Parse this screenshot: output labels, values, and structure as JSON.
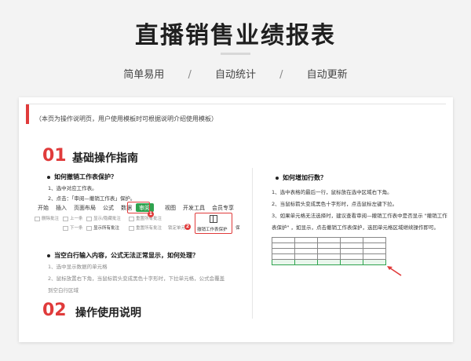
{
  "header": {
    "title": "直播销售业绩报表",
    "subtitles": [
      "简单易用",
      "自动统计",
      "自动更新"
    ],
    "separator": "/"
  },
  "card": {
    "note": "（本页为操作说明页，用户使用模板时可根据说明介绍使用模板）",
    "section1": {
      "num": "01",
      "title": "基础操作指南"
    },
    "section2": {
      "num": "02",
      "title": "操作使用说明"
    },
    "left": {
      "q1": "如何撤销工作表保护？",
      "q1_steps": [
        "1、选中对应工作表。",
        "2、点击：「审阅—撤销工作表」保护。"
      ],
      "ribbon_tabs": [
        "开始",
        "插入",
        "页面布局",
        "公式",
        "数据",
        "审阅",
        "视图",
        "开发工具",
        "会员专享"
      ],
      "ribbon_tools": [
        "删除批注",
        "上一条",
        "显示/隐藏批注",
        "重置所有批注",
        "锁定单元格",
        "撤销工作表保护",
        "保"
      ],
      "ribbon_tools_row2": [
        "下一条",
        "显示所有批注",
        "重置所有批注"
      ],
      "badges": [
        "1",
        "2"
      ],
      "q2": "当空白行输入内容，公式无法正常显示，如何处理？",
      "q2_steps": [
        "1、选中显示数据的单元格",
        "2、鼠标放置右下角，当鼠标箭头变成黑色十字形时，下拉单元格，公式会覆盖",
        "到空白行区域"
      ]
    },
    "right": {
      "q": "如何增加行数？",
      "steps": [
        "1、选中表格的最后一行，鼠标放在选中区域右下角。",
        "2、当鼠标箭头变成黑色十字形时，点击鼠标左键下拉。",
        "3、如果单元格无法选择时，建议查看审阅—撤销工作表中是否显示 \"撤销工作",
        "表保护\" ，如显示，点击撤销工作表保护，选回单元格区域继续操作即可。"
      ]
    }
  },
  "colors": {
    "accent": "#e03b3b",
    "green": "#2fa34f"
  }
}
